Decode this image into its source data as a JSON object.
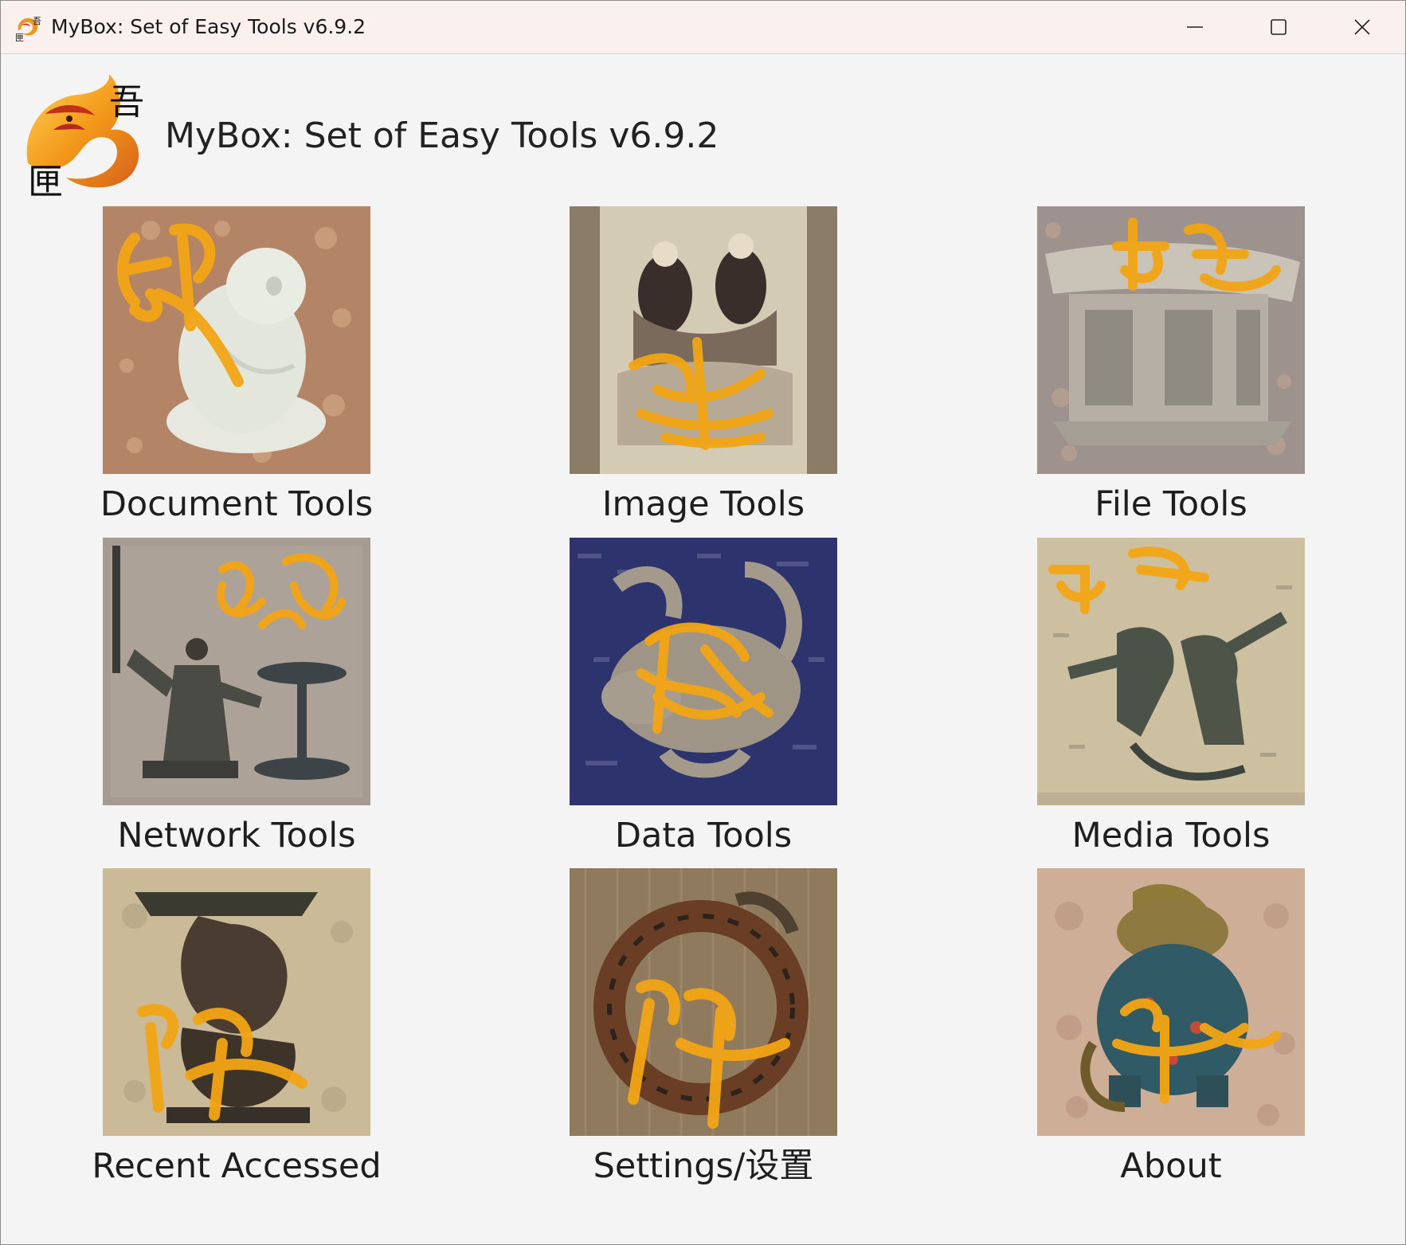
{
  "window": {
    "title": "MyBox: Set of Easy Tools v6.9.2",
    "controls": [
      "minimize-icon",
      "maximize-icon",
      "close-icon"
    ]
  },
  "header": {
    "title": "MyBox: Set of Easy Tools v6.9.2",
    "logo_icon": "mybox-logo-icon"
  },
  "tools": [
    {
      "label": "Document Tools",
      "icon": "jade-figure-image",
      "bg": "#b88a6a"
    },
    {
      "label": "Image Tools",
      "icon": "ancient-painting-image",
      "bg": "#b7ad96"
    },
    {
      "label": "File Tools",
      "icon": "porcelain-pavilion-image",
      "bg": "#a49a95"
    },
    {
      "label": "Network Tools",
      "icon": "bronze-lamp-figure-image",
      "bg": "#a79e95"
    },
    {
      "label": "Data Tools",
      "icon": "stone-turtle-snake-image",
      "bg": "#2f3570"
    },
    {
      "label": "Media Tools",
      "icon": "bronze-dancers-image",
      "bg": "#cdbf9e"
    },
    {
      "label": "Recent Accessed",
      "icon": "bronze-lamp-stand-image",
      "bg": "#c9b995"
    },
    {
      "label": "Settings/设置",
      "icon": "coiled-serpent-image",
      "bg": "#927b5e"
    },
    {
      "label": "About",
      "icon": "cloisonne-beast-image",
      "bg": "#d0b09b"
    }
  ],
  "colors": {
    "titlebar_bg": "#faf1ef",
    "window_bg": "#f4f4f4",
    "calligraphy_gold": "#f0a81c"
  }
}
